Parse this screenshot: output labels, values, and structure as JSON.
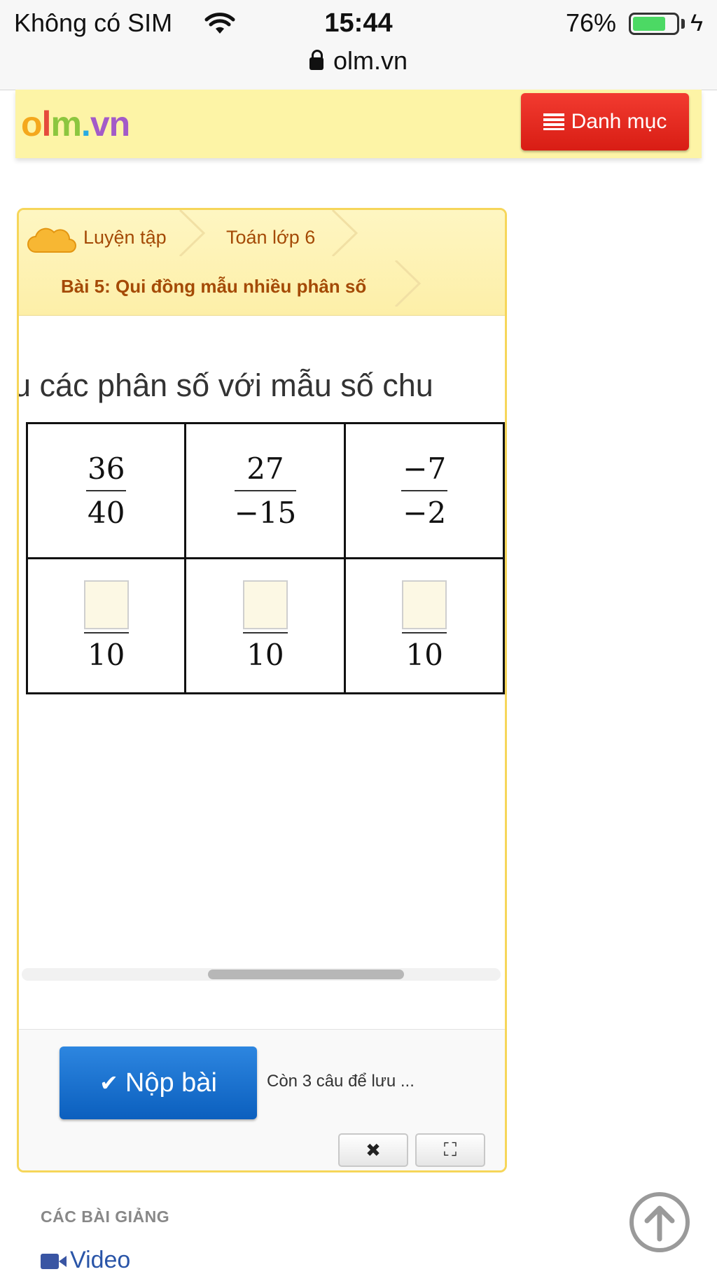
{
  "status_bar": {
    "carrier": "Không có SIM",
    "time": "15:44",
    "battery_percent": "76%",
    "battery_level": 0.76,
    "url": "olm.vn"
  },
  "header": {
    "logo": {
      "o": "o",
      "l": "l",
      "m": "m",
      "dot": ".",
      "v": "v",
      "n": "n"
    },
    "logo_colors": [
      "#f4a81d",
      "#e54b3c",
      "#8cc63f",
      "#29abe2",
      "#a35bc8",
      "#a35bc8"
    ],
    "menu_label": "Danh mục"
  },
  "breadcrumb": {
    "items": [
      "Luyện tập",
      "Toán lớp 6",
      "Bài 5: Qui đồng mẫu nhiều phân số"
    ]
  },
  "question": {
    "text": "u các phân số với mẫu số chu"
  },
  "fractions_table": {
    "given": [
      {
        "num": "36",
        "den": "40"
      },
      {
        "num": "27",
        "den": "−15"
      },
      {
        "num": "−7",
        "den": "−2"
      }
    ],
    "answers": [
      {
        "den": "10"
      },
      {
        "den": "10"
      },
      {
        "den": "10"
      }
    ]
  },
  "footer": {
    "submit_label": "Nộp bài",
    "remaining_text": "Còn 3 câu để lưu ...",
    "close_icon": "✖",
    "fullscreen_icon": "⛶"
  },
  "lessons": {
    "title": "CÁC BÀI GIẢNG",
    "video_label": "Video"
  },
  "icons": {
    "wifi": "wifi-icon",
    "lock": "lock-icon",
    "menu": "list-icon",
    "check": "checkmark-icon",
    "video": "video-camera-icon",
    "scroll_top": "arrow-up-circle-icon"
  },
  "colors": {
    "header_bg": "#fdf4a6",
    "menu_button": "#e2261c",
    "submit_button": "#1b6fcf",
    "breadcrumb_text": "#a44a06",
    "panel_border": "#f6d65a"
  }
}
